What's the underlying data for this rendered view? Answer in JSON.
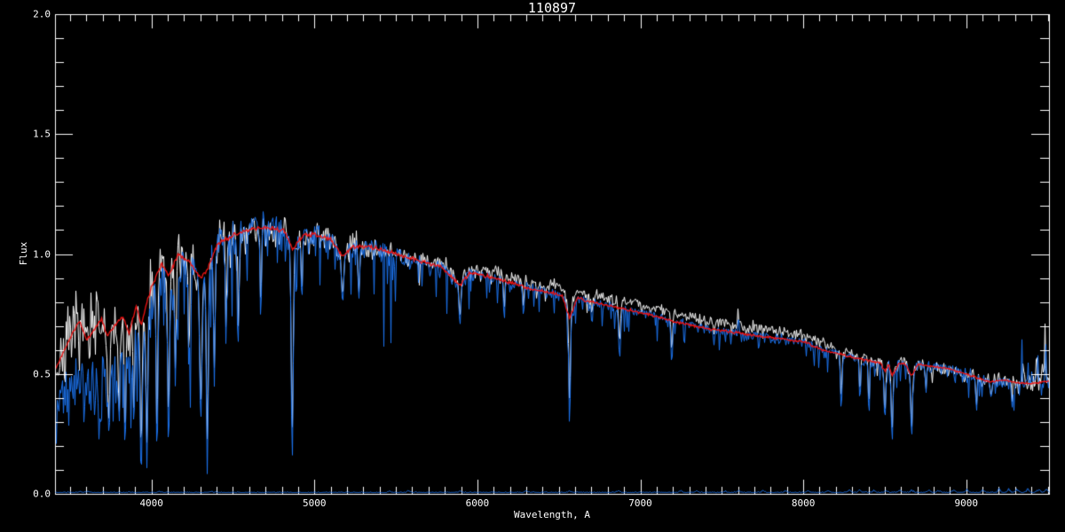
{
  "chart_data": {
    "type": "line",
    "title": "110897",
    "xlabel": "Wavelength, A",
    "ylabel": "Flux",
    "xlim": [
      3408,
      9508
    ],
    "ylim": [
      0,
      2
    ],
    "x_major_ticks": [
      4000,
      5000,
      6000,
      7000,
      8000,
      9000
    ],
    "x_tick_labels": [
      "4000",
      "5000",
      "6000",
      "7000",
      "8000",
      "9000"
    ],
    "x_minor_step": 100,
    "y_major_ticks": [
      2.0,
      1.5,
      1.0,
      0.5,
      0.0
    ],
    "y_tick_labels": [
      "2.0",
      "1.5",
      "1.0",
      "0.5",
      "0.0"
    ],
    "y_minor_step": 0.1,
    "grid": false,
    "legend": "none",
    "colors": {
      "background": "#000000",
      "axis": "#ffffff",
      "observed": "#1c74f0",
      "model": "#f01212",
      "comparison": "#ffffff"
    },
    "series": [
      {
        "name": "observed-spectrum",
        "color": "#1c74f0",
        "style": "noisy spectrum with deep absorption spikes"
      },
      {
        "name": "comparison-spectrum",
        "color": "#ffffff",
        "style": "noisy spectrum"
      },
      {
        "name": "model-fit-spectrum",
        "color": "#f01212",
        "style": "smooth fitted spectrum"
      },
      {
        "name": "error-spectrum",
        "color": "#1c74f0",
        "style": "thin line along flux 0"
      }
    ],
    "model_points": [
      [
        3408,
        0.52
      ],
      [
        3470,
        0.61
      ],
      [
        3520,
        0.68
      ],
      [
        3556,
        0.72
      ],
      [
        3600,
        0.64
      ],
      [
        3650,
        0.69
      ],
      [
        3690,
        0.73
      ],
      [
        3725,
        0.66
      ],
      [
        3770,
        0.7
      ],
      [
        3820,
        0.74
      ],
      [
        3860,
        0.67
      ],
      [
        3905,
        0.79
      ],
      [
        3934,
        0.7
      ],
      [
        3965,
        0.79
      ],
      [
        4000,
        0.87
      ],
      [
        4060,
        0.96
      ],
      [
        4102,
        0.91
      ],
      [
        4160,
        1.0
      ],
      [
        4227,
        0.97
      ],
      [
        4300,
        0.9
      ],
      [
        4345,
        0.94
      ],
      [
        4400,
        1.04
      ],
      [
        4500,
        1.08
      ],
      [
        4600,
        1.1
      ],
      [
        4700,
        1.11
      ],
      [
        4810,
        1.1
      ],
      [
        4861,
        1.02
      ],
      [
        4930,
        1.08
      ],
      [
        5000,
        1.08
      ],
      [
        5100,
        1.06
      ],
      [
        5170,
        0.99
      ],
      [
        5230,
        1.03
      ],
      [
        5330,
        1.03
      ],
      [
        5450,
        1.01
      ],
      [
        5550,
        0.99
      ],
      [
        5650,
        0.97
      ],
      [
        5780,
        0.945
      ],
      [
        5890,
        0.87
      ],
      [
        5950,
        0.92
      ],
      [
        6050,
        0.91
      ],
      [
        6150,
        0.89
      ],
      [
        6250,
        0.87
      ],
      [
        6350,
        0.85
      ],
      [
        6450,
        0.84
      ],
      [
        6520,
        0.825
      ],
      [
        6563,
        0.73
      ],
      [
        6610,
        0.815
      ],
      [
        6700,
        0.8
      ],
      [
        6800,
        0.785
      ],
      [
        6900,
        0.77
      ],
      [
        7000,
        0.755
      ],
      [
        7100,
        0.74
      ],
      [
        7200,
        0.72
      ],
      [
        7300,
        0.705
      ],
      [
        7400,
        0.69
      ],
      [
        7500,
        0.68
      ],
      [
        7600,
        0.67
      ],
      [
        7700,
        0.66
      ],
      [
        7800,
        0.652
      ],
      [
        7900,
        0.643
      ],
      [
        8000,
        0.635
      ],
      [
        8060,
        0.615
      ],
      [
        8120,
        0.598
      ],
      [
        8200,
        0.586
      ],
      [
        8300,
        0.57
      ],
      [
        8400,
        0.556
      ],
      [
        8470,
        0.545
      ],
      [
        8498,
        0.51
      ],
      [
        8520,
        0.54
      ],
      [
        8542,
        0.49
      ],
      [
        8580,
        0.54
      ],
      [
        8620,
        0.545
      ],
      [
        8662,
        0.49
      ],
      [
        8700,
        0.54
      ],
      [
        8800,
        0.53
      ],
      [
        8900,
        0.52
      ],
      [
        9000,
        0.5
      ],
      [
        9080,
        0.48
      ],
      [
        9150,
        0.465
      ],
      [
        9220,
        0.475
      ],
      [
        9300,
        0.465
      ],
      [
        9400,
        0.46
      ],
      [
        9508,
        0.47
      ]
    ],
    "absorption_lines": [
      [
        3735,
        6,
        0.22
      ],
      [
        3798,
        5,
        0.25
      ],
      [
        3835,
        5,
        0.18
      ],
      [
        3889,
        5,
        0.24
      ],
      [
        3934,
        6,
        0.11
      ],
      [
        3969,
        6,
        0.14
      ],
      [
        4031,
        5,
        0.13
      ],
      [
        4102,
        6,
        0.19
      ],
      [
        4144,
        5,
        0.45
      ],
      [
        4227,
        4,
        0.45
      ],
      [
        4300,
        7,
        0.3
      ],
      [
        4340,
        6,
        0.1
      ],
      [
        4383,
        5,
        0.45
      ],
      [
        4455,
        4,
        0.6
      ],
      [
        4531,
        4,
        0.62
      ],
      [
        4668,
        4,
        0.7
      ],
      [
        4861,
        6,
        0.13
      ],
      [
        4920,
        4,
        0.8
      ],
      [
        5170,
        7,
        0.8
      ],
      [
        5270,
        5,
        0.82
      ],
      [
        5890,
        6,
        0.7
      ],
      [
        6162,
        4,
        0.72
      ],
      [
        6280,
        4,
        0.74
      ],
      [
        6563,
        5,
        0.28
      ],
      [
        6700,
        4,
        0.7
      ],
      [
        6870,
        6,
        0.57
      ],
      [
        7190,
        5,
        0.54
      ],
      [
        7450,
        4,
        0.62
      ],
      [
        8230,
        5,
        0.35
      ],
      [
        8345,
        4,
        0.38
      ],
      [
        8400,
        4,
        0.32
      ],
      [
        8498,
        5,
        0.3
      ],
      [
        8542,
        5,
        0.21
      ],
      [
        8662,
        5,
        0.23
      ],
      [
        8750,
        4,
        0.42
      ],
      [
        9060,
        4,
        0.34
      ],
      [
        9150,
        5,
        0.4
      ],
      [
        9280,
        4,
        0.37
      ]
    ],
    "observed": {
      "factor_points": [
        [
          3408,
          0.7
        ],
        [
          3550,
          0.72
        ],
        [
          3700,
          0.72
        ],
        [
          3800,
          0.74
        ],
        [
          3880,
          0.78
        ],
        [
          3960,
          0.86
        ],
        [
          4050,
          0.93
        ],
        [
          4150,
          0.96
        ],
        [
          4250,
          0.99
        ],
        [
          4350,
          1.0
        ],
        [
          9508,
          1.0
        ]
      ],
      "sigma_points": [
        [
          3408,
          0.15
        ],
        [
          3900,
          0.14
        ],
        [
          4000,
          0.11
        ],
        [
          4300,
          0.075
        ],
        [
          4600,
          0.05
        ],
        [
          5000,
          0.04
        ],
        [
          5500,
          0.032
        ],
        [
          6000,
          0.027
        ],
        [
          6500,
          0.025
        ],
        [
          7000,
          0.025
        ],
        [
          7600,
          0.028
        ],
        [
          8200,
          0.03
        ],
        [
          8700,
          0.038
        ],
        [
          9100,
          0.048
        ],
        [
          9508,
          0.06
        ]
      ],
      "spike_prob_points": [
        [
          3408,
          0.3
        ],
        [
          4000,
          0.28
        ],
        [
          4300,
          0.2
        ],
        [
          4700,
          0.14
        ],
        [
          5200,
          0.1
        ],
        [
          6000,
          0.07
        ],
        [
          6700,
          0.06
        ],
        [
          7500,
          0.06
        ],
        [
          8300,
          0.1
        ],
        [
          9508,
          0.12
        ]
      ],
      "spike_depth_points": [
        [
          3408,
          0.4
        ],
        [
          4000,
          0.45
        ],
        [
          4300,
          0.35
        ],
        [
          4700,
          0.28
        ],
        [
          5200,
          0.22
        ],
        [
          6000,
          0.18
        ],
        [
          6700,
          0.15
        ],
        [
          7500,
          0.13
        ],
        [
          8300,
          0.2
        ],
        [
          9508,
          0.22
        ]
      ],
      "bumps": [
        [
          7600,
          4,
          0.05
        ],
        [
          9440,
          5,
          0.1
        ],
        [
          9485,
          4,
          0.14
        ]
      ]
    },
    "comparison": {
      "offset_points": [
        [
          3408,
          0
        ],
        [
          5500,
          0
        ],
        [
          6000,
          0.02
        ],
        [
          6600,
          0.03
        ],
        [
          7000,
          0.035
        ],
        [
          7800,
          0.035
        ],
        [
          8200,
          0.02
        ],
        [
          8450,
          0.005
        ],
        [
          8700,
          0
        ],
        [
          9508,
          0
        ]
      ],
      "line_depth_scale": 0.85,
      "bumps": [
        [
          7600,
          5,
          0.06
        ],
        [
          8120,
          5,
          0.03
        ],
        [
          9350,
          5,
          0.08
        ],
        [
          9430,
          4,
          0.12
        ],
        [
          9480,
          4,
          0.15
        ]
      ]
    },
    "error_spectrum": {
      "base": 0.005,
      "sigma": 0.002,
      "bump_sigma": 9,
      "bumps": [
        [
          3560,
          0.004
        ],
        [
          3610,
          0.004
        ],
        [
          4046,
          0.005
        ],
        [
          4358,
          0.005
        ],
        [
          5461,
          0.007
        ],
        [
          5577,
          0.01
        ],
        [
          5890,
          0.007
        ],
        [
          6300,
          0.009
        ],
        [
          6563,
          0.005
        ],
        [
          6863,
          0.008
        ],
        [
          7245,
          0.009
        ],
        [
          7340,
          0.007
        ],
        [
          7520,
          0.007
        ],
        [
          7600,
          0.008
        ],
        [
          7750,
          0.008
        ],
        [
          7890,
          0.007
        ],
        [
          8025,
          0.007
        ],
        [
          8150,
          0.007
        ],
        [
          8280,
          0.009
        ],
        [
          8344,
          0.01
        ],
        [
          8430,
          0.01
        ],
        [
          8505,
          0.009
        ],
        [
          8590,
          0.009
        ],
        [
          8665,
          0.01
        ],
        [
          8767,
          0.011
        ],
        [
          8830,
          0.011
        ],
        [
          8919,
          0.012
        ],
        [
          9001,
          0.012
        ],
        [
          9100,
          0.011
        ],
        [
          9200,
          0.013
        ],
        [
          9260,
          0.012
        ],
        [
          9310,
          0.013
        ],
        [
          9375,
          0.013
        ],
        [
          9440,
          0.014
        ],
        [
          9490,
          0.014
        ]
      ]
    }
  }
}
